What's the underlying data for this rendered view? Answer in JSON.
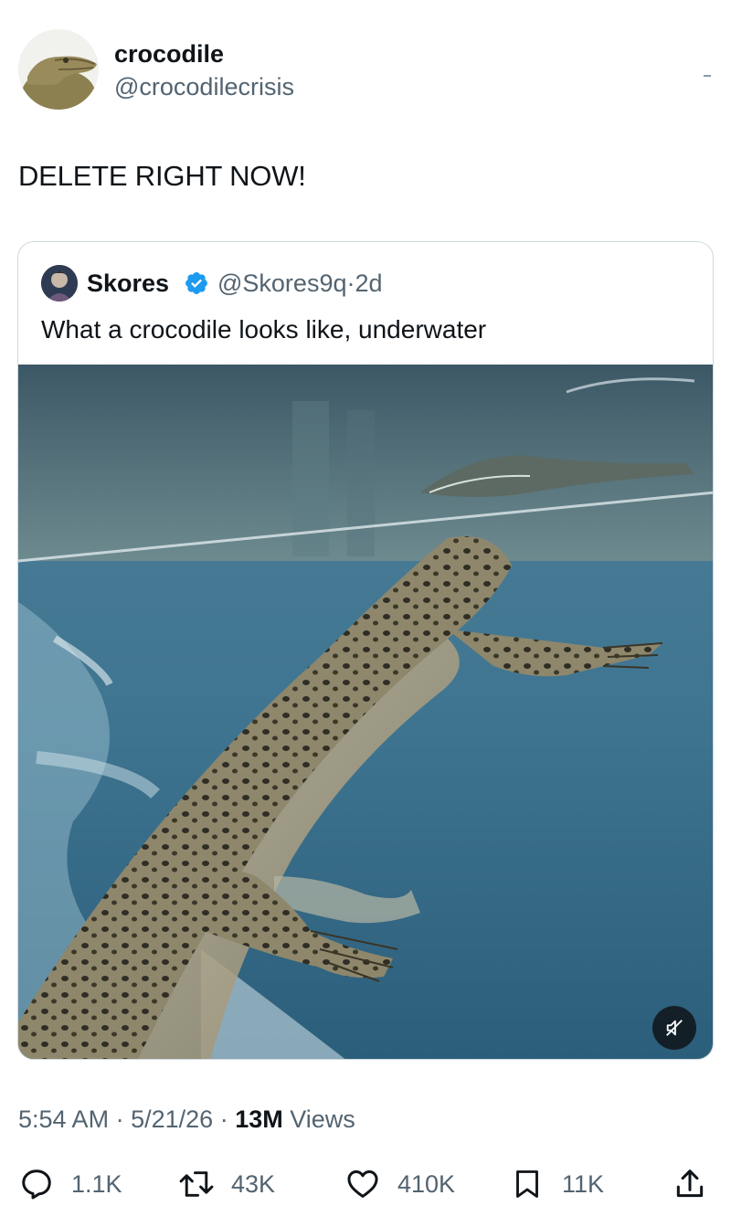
{
  "post": {
    "author_name": "crocodile",
    "author_handle": "@crocodilecrisis",
    "text": "DELETE RIGHT NOW!"
  },
  "quoted": {
    "author_name": "Skores",
    "author_handle": "@Skores9q",
    "age_separator": "·",
    "age": "2d",
    "text": "What a crocodile looks like, underwater"
  },
  "meta": {
    "time": "5:54 AM",
    "sep1": "·",
    "date": "5/21/26",
    "sep2": "·",
    "views_count": "13M",
    "views_label": "Views"
  },
  "actions": {
    "replies": "1.1K",
    "reposts": "43K",
    "likes": "410K",
    "bookmarks": "11K"
  },
  "icons": {
    "reply": "reply-icon",
    "repost": "repost-icon",
    "like": "heart-icon",
    "bookmark": "bookmark-icon",
    "share": "share-icon",
    "mute": "muted-speaker-icon",
    "verified": "verified-badge-icon"
  },
  "colors": {
    "text_primary": "#0f1419",
    "text_secondary": "#536471",
    "verified_blue": "#1d9bf0",
    "border": "#cfd9de"
  }
}
